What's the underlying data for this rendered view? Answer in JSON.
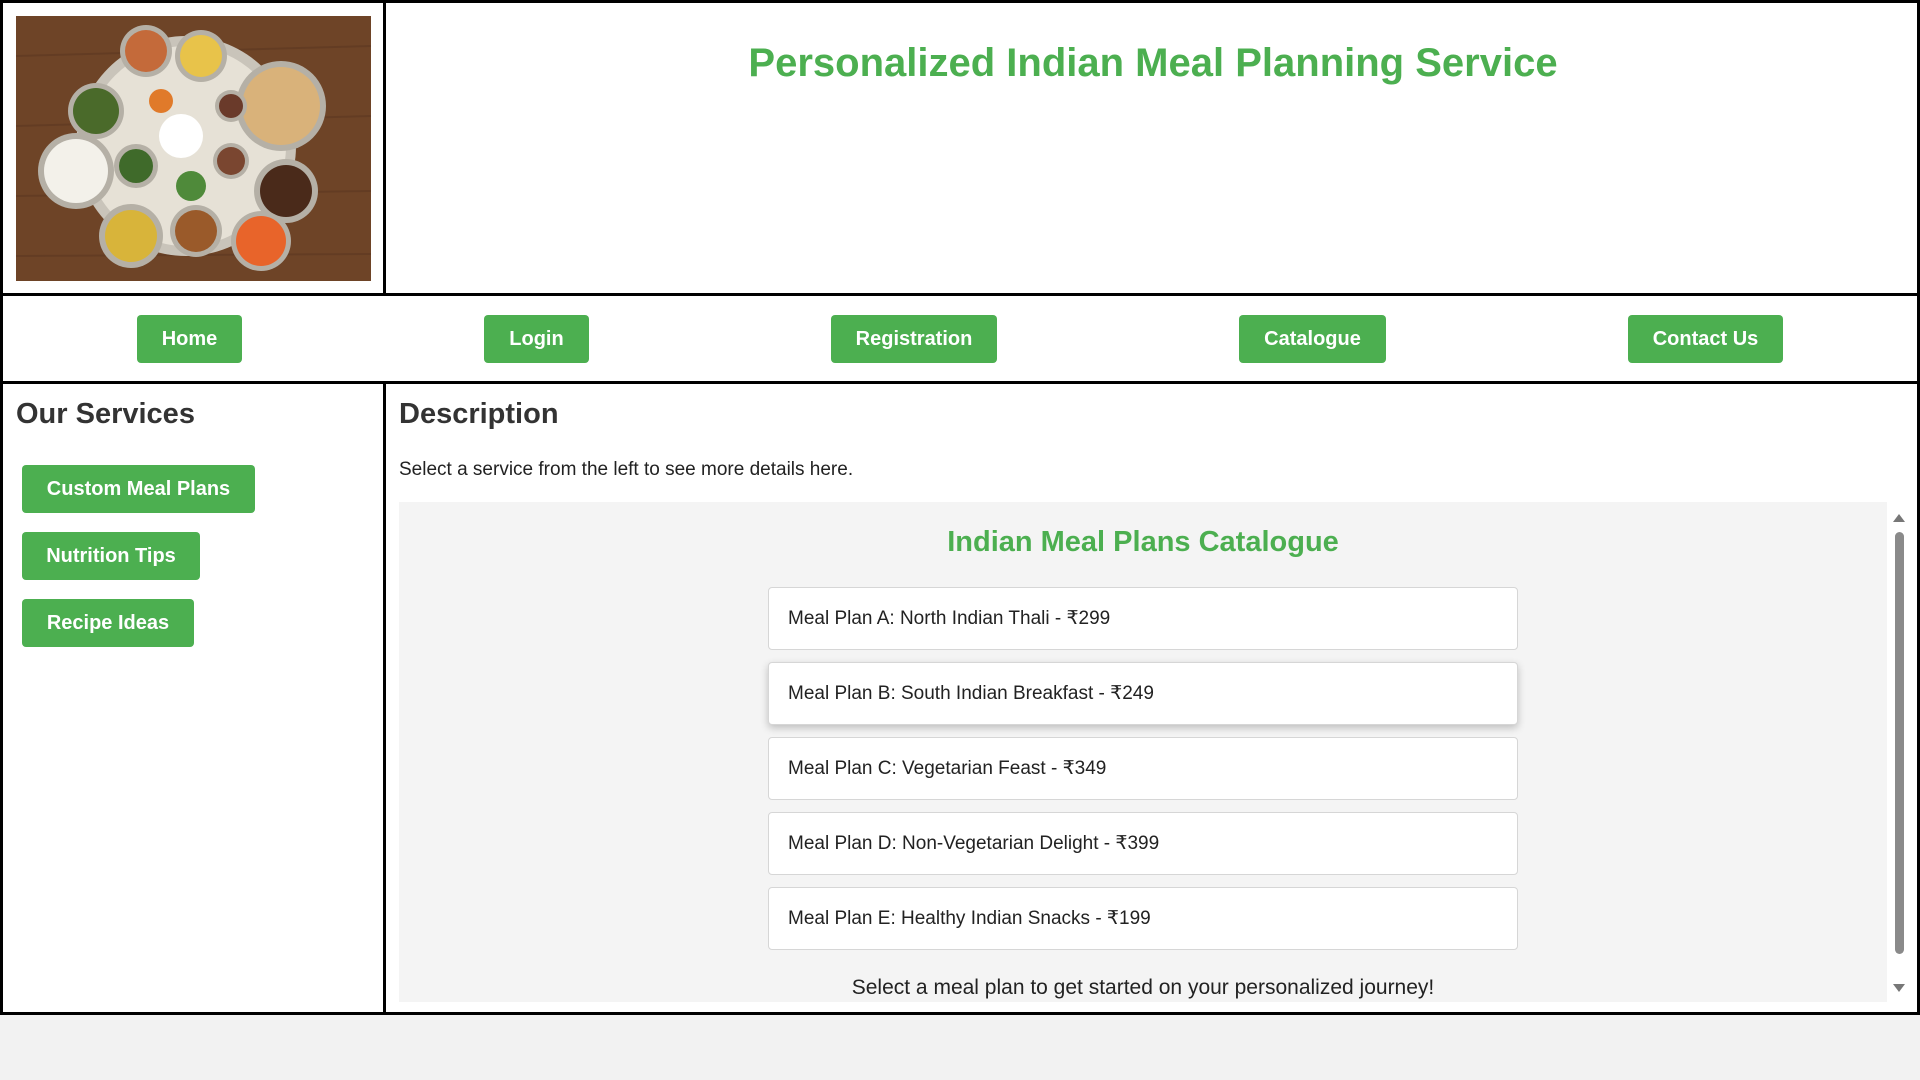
{
  "header": {
    "title": "Personalized Indian Meal Planning Service",
    "logo_icon": "indian-thali-food-image"
  },
  "nav": {
    "items": [
      {
        "label": "Home"
      },
      {
        "label": "Login"
      },
      {
        "label": "Registration"
      },
      {
        "label": "Catalogue"
      },
      {
        "label": "Contact Us"
      }
    ]
  },
  "sidebar": {
    "title": "Our Services",
    "items": [
      {
        "label": "Custom Meal Plans"
      },
      {
        "label": "Nutrition Tips"
      },
      {
        "label": "Recipe Ideas"
      }
    ]
  },
  "main": {
    "title": "Description",
    "text": "Select a service from the left to see more details here.",
    "catalogue": {
      "title": "Indian Meal Plans Catalogue",
      "plans": [
        {
          "label": "Meal Plan A: North Indian Thali - ₹299"
        },
        {
          "label": "Meal Plan B: South Indian Breakfast - ₹249"
        },
        {
          "label": "Meal Plan C: Vegetarian Feast - ₹349"
        },
        {
          "label": "Meal Plan D: Non-Vegetarian Delight - ₹399"
        },
        {
          "label": "Meal Plan E: Healthy Indian Snacks - ₹199"
        }
      ],
      "footer": "Select a meal plan to get started on your personalized journey!"
    }
  },
  "colors": {
    "accent": "#4caf50",
    "border": "#000000",
    "catalogue_bg": "#f4f4f4"
  }
}
